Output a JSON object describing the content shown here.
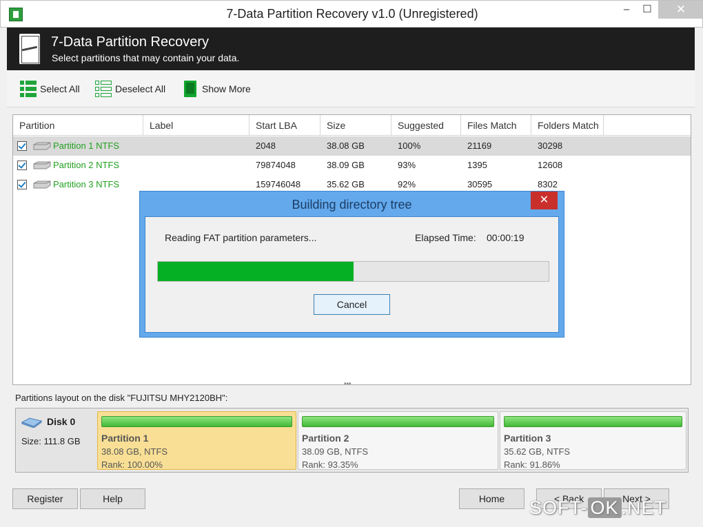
{
  "window": {
    "title": "7-Data Partition Recovery v1.0 (Unregistered)",
    "minimize": "‒",
    "maximize": "☐",
    "close": "✕"
  },
  "header": {
    "title": "7-Data Partition Recovery",
    "subtitle": "Select partitions that may contain your data."
  },
  "toolbar": {
    "select_all": "Select All",
    "deselect_all": "Deselect All",
    "show_more": "Show More"
  },
  "table": {
    "columns": [
      "Partition",
      "Label",
      "Start LBA",
      "Size",
      "Suggested",
      "Files Match",
      "Folders Match"
    ],
    "rows": [
      {
        "checked": true,
        "partition": "Partition 1 NTFS",
        "label": "",
        "start_lba": "2048",
        "size": "38.08 GB",
        "suggested": "100%",
        "files": "21169",
        "folders": "30298"
      },
      {
        "checked": true,
        "partition": "Partition 2 NTFS",
        "label": "",
        "start_lba": "79874048",
        "size": "38.09 GB",
        "suggested": "93%",
        "files": "1395",
        "folders": "12608"
      },
      {
        "checked": true,
        "partition": "Partition 3 NTFS",
        "label": "",
        "start_lba": "159746048",
        "size": "35.62 GB",
        "suggested": "92%",
        "files": "30595",
        "folders": "8302"
      }
    ],
    "splitter": "•••"
  },
  "dialog": {
    "title": "Building directory tree",
    "close": "✕",
    "status": "Reading FAT partition parameters...",
    "elapsed_label": "Elapsed Time:",
    "elapsed_value": "00:00:19",
    "progress": 0.5,
    "cancel": "Cancel"
  },
  "layout": {
    "caption": "Partitions layout on the disk \"FUJITSU MHY2120BH\":",
    "disk": {
      "name": "Disk 0",
      "size": "Size: 111.8 GB"
    },
    "partitions": [
      {
        "name": "Partition 1",
        "info": "38.08 GB, NTFS",
        "rank": "Rank: 100.00%"
      },
      {
        "name": "Partition 2",
        "info": "38.09 GB, NTFS",
        "rank": "Rank: 93.35%"
      },
      {
        "name": "Partition 3",
        "info": "35.62 GB, NTFS",
        "rank": "Rank: 91.86%"
      }
    ]
  },
  "buttons": {
    "register": "Register",
    "help": "Help",
    "home": "Home",
    "back": "< Back",
    "next": "Next >"
  },
  "watermark": {
    "a": "SOFT-",
    "b": "OK",
    "c": ".NET"
  },
  "colors": {
    "accent_green": "#22a020",
    "progress_green": "#06b025",
    "dialog_blue": "#63a9ec",
    "header_bg": "#1e1e1e"
  }
}
